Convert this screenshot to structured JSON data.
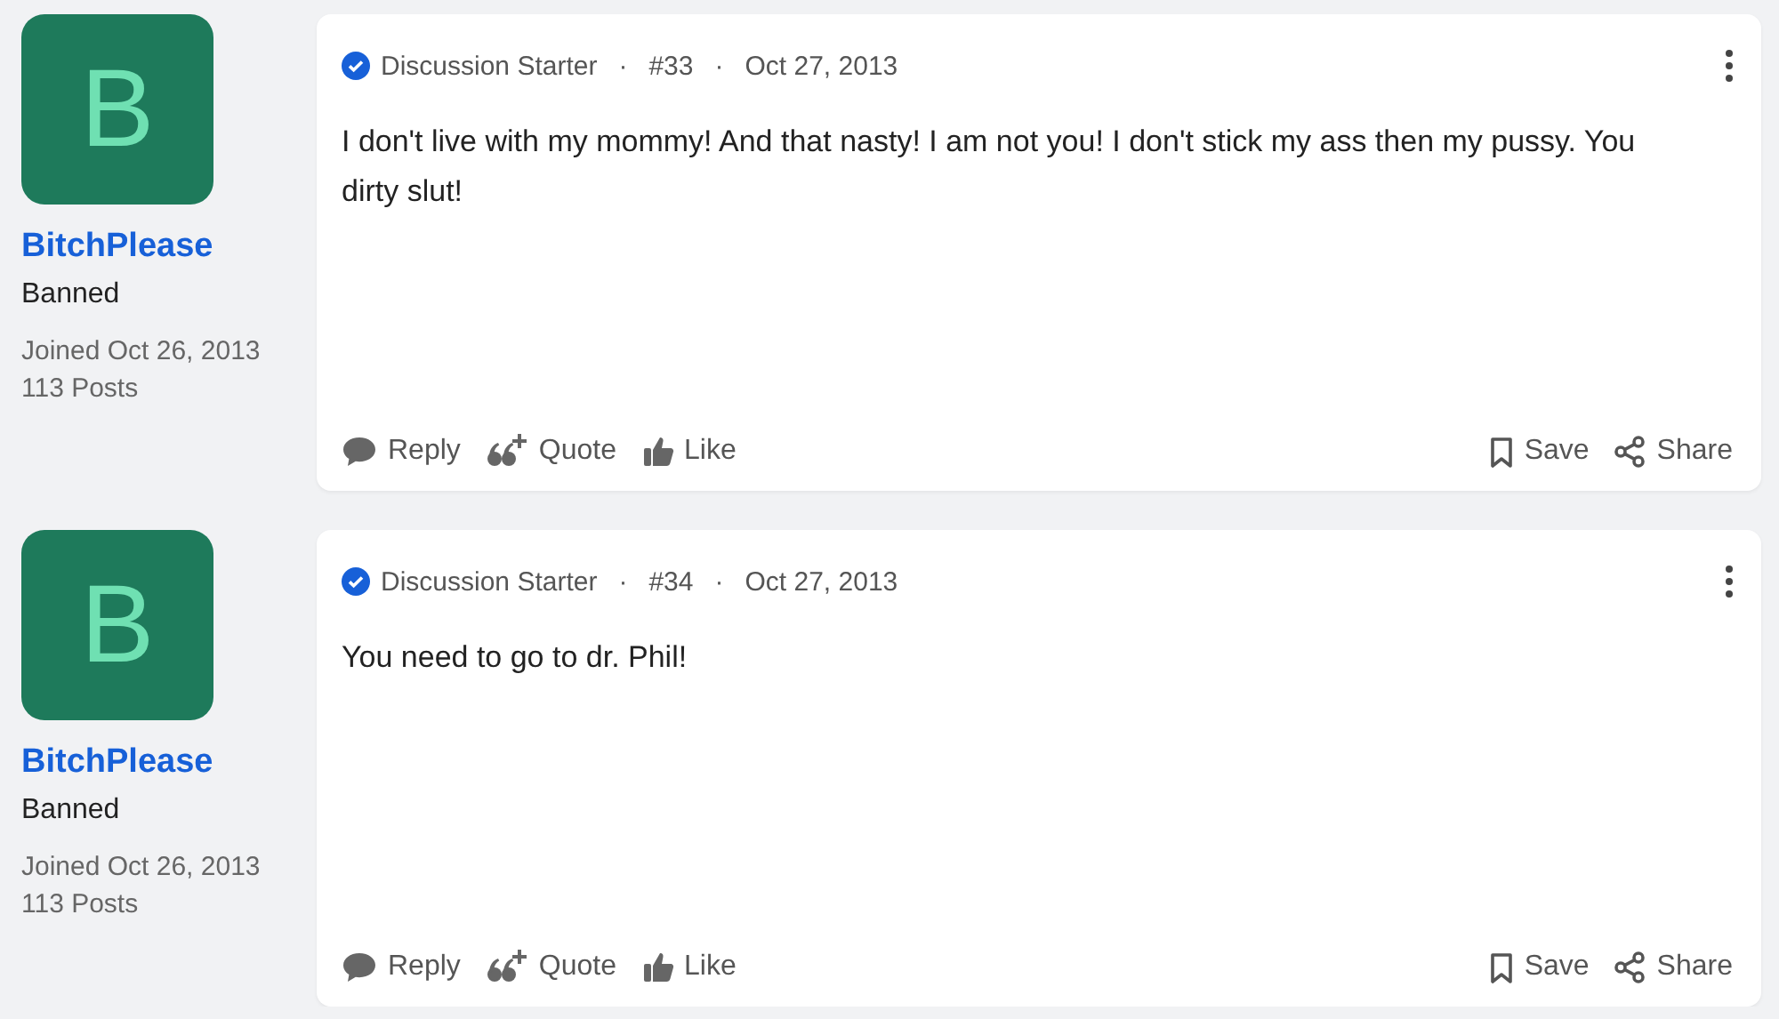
{
  "posts": [
    {
      "author": {
        "initial": "B",
        "name": "BitchPlease",
        "rank": "Banned",
        "joined": "Joined Oct 26, 2013",
        "posts": "113 Posts"
      },
      "badge": "Discussion Starter",
      "separator": "·",
      "number": "#33",
      "date": "Oct 27, 2013",
      "body": "I don't live with my mommy! And that nasty! I am not you! I don't stick my ass then my pussy. You dirty slut!",
      "actions": [
        {
          "kind": "reply",
          "label": "Reply"
        },
        {
          "kind": "quote",
          "label": "Quote"
        },
        {
          "kind": "like",
          "label": "Like"
        },
        {
          "kind": "save",
          "label": "Save"
        },
        {
          "kind": "share",
          "label": "Share"
        }
      ]
    },
    {
      "author": {
        "initial": "B",
        "name": "BitchPlease",
        "rank": "Banned",
        "joined": "Joined Oct 26, 2013",
        "posts": "113 Posts"
      },
      "badge": "Discussion Starter",
      "separator": "·",
      "number": "#34",
      "date": "Oct 27, 2013",
      "body": "You need to go to dr. Phil!",
      "actions": [
        {
          "kind": "reply",
          "label": "Reply"
        },
        {
          "kind": "quote",
          "label": "Quote"
        },
        {
          "kind": "like",
          "label": "Like"
        },
        {
          "kind": "save",
          "label": "Save"
        },
        {
          "kind": "share",
          "label": "Share"
        }
      ]
    }
  ]
}
